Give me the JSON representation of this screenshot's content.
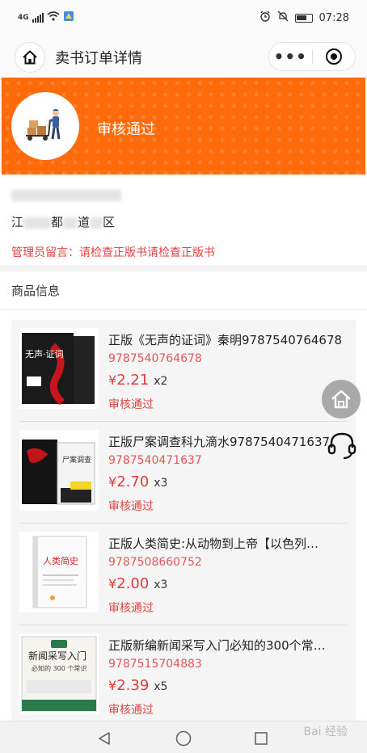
{
  "status_bar": {
    "network": "4G",
    "time": "07:28"
  },
  "navbar": {
    "title": "卖书订单详情",
    "menu_label": "•••"
  },
  "banner": {
    "status": "审核通过",
    "color": "#ff6a0a"
  },
  "address": {
    "line2_start": "江",
    "line2_mid": "都",
    "line2_end": "道",
    "line2_tail": "区",
    "admin_note": "管理员留言：请检查正版书请检查正版书"
  },
  "goods": {
    "header": "商品信息",
    "items": [
      {
        "title": "正版《无声的证词》秦明9787540764678",
        "isbn": "9787540764678",
        "currency": "¥",
        "price": "2.21",
        "qty": "x2",
        "status": "审核通过",
        "cover_text": "无声·证词"
      },
      {
        "title": "正版尸案调查科九滴水9787540471637",
        "isbn": "9787540471637",
        "currency": "¥",
        "price": "2.70",
        "qty": "x3",
        "status": "审核通过",
        "cover_text": "尸案调查"
      },
      {
        "title": "正版人类简史:从动物到上帝【以色列…",
        "isbn": "9787508660752",
        "currency": "¥",
        "price": "2.00",
        "qty": "x3",
        "status": "审核通过",
        "cover_text": "人类简史"
      },
      {
        "title": "正版新编新闻采写入门必知的300个常…",
        "isbn": "9787515704883",
        "currency": "¥",
        "price": "2.39",
        "qty": "x5",
        "status": "审核通过",
        "cover_text": "新闻采写入门",
        "cover_subtext": "必知的 300 个常识"
      }
    ]
  },
  "watermark": "Bai 经验"
}
